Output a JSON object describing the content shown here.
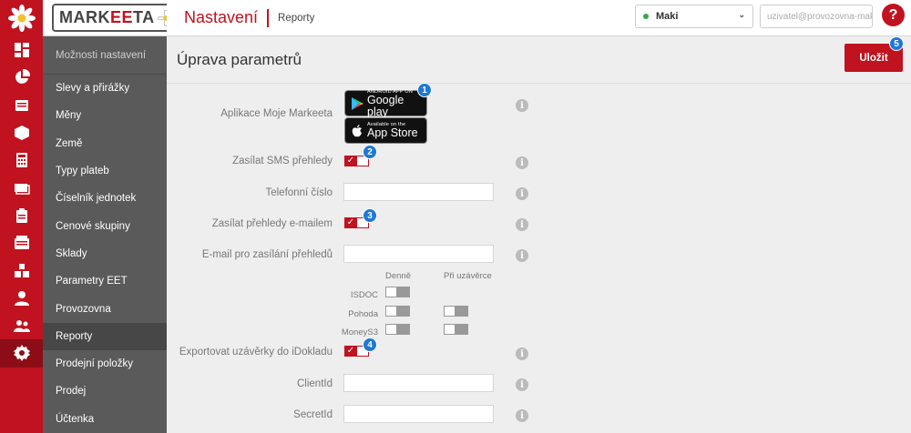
{
  "app": {
    "brand_prefix": "MARK",
    "brand_accent": "EE",
    "brand_suffix": "TA",
    "accent_color": "#c0121f"
  },
  "rail_icons": [
    "dashboard-icon",
    "pie-chart-icon",
    "receipt-icon",
    "box-icon",
    "calculator-icon",
    "cash-icon",
    "clipboard-icon",
    "register-icon",
    "boxes-icon",
    "user-icon",
    "users-icon",
    "settings-icon"
  ],
  "sidebar": {
    "header": "Možnosti nastavení",
    "items": [
      {
        "label": "Slevy a přirážky"
      },
      {
        "label": "Měny"
      },
      {
        "label": "Země"
      },
      {
        "label": "Typy plateb"
      },
      {
        "label": "Číselník jednotek"
      },
      {
        "label": "Cenové skupiny"
      },
      {
        "label": "Sklady"
      },
      {
        "label": "Parametry EET"
      },
      {
        "label": "Provozovna"
      },
      {
        "label": "Reporty",
        "active": true
      },
      {
        "label": "Prodejní položky"
      },
      {
        "label": "Prodej"
      },
      {
        "label": "Účtenka"
      }
    ]
  },
  "topbar": {
    "title": "Nastavení",
    "subtitle": "Reporty",
    "store_select": "Maki",
    "user_email": "uzivatel@provozovna-maki.cz",
    "help_label": "?"
  },
  "content": {
    "page_title": "Úprava parametrů",
    "save_label": "Uložit",
    "badges": [
      "1",
      "2",
      "3",
      "4",
      "5"
    ],
    "info_label": "i",
    "fields": {
      "app_label": "Aplikace Moje Markeeta",
      "google_small": "ANDROID APP ON",
      "google_big": "Google play",
      "apple_small": "Available on the",
      "apple_big": "App Store",
      "sms_label": "Zasílat SMS přehledy",
      "sms_on": true,
      "phone_label": "Telefonní číslo",
      "phone_value": "",
      "email_reports_label": "Zasílat přehledy e-mailem",
      "email_reports_on": true,
      "email_label": "E-mail pro zasílání přehledů",
      "email_value": "",
      "col_daily": "Denně",
      "col_closing": "Při uzávěrce",
      "exports": [
        {
          "label": "ISDOC",
          "daily": false,
          "closing": null
        },
        {
          "label": "Pohoda",
          "daily": false,
          "closing": false
        },
        {
          "label": "MoneyS3",
          "daily": false,
          "closing": false
        }
      ],
      "idoklad_label": "Exportovat uzávěrky do iDokladu",
      "idoklad_on": true,
      "client_label": "ClientId",
      "client_value": "",
      "secret_label": "SecretId",
      "secret_value": ""
    }
  }
}
